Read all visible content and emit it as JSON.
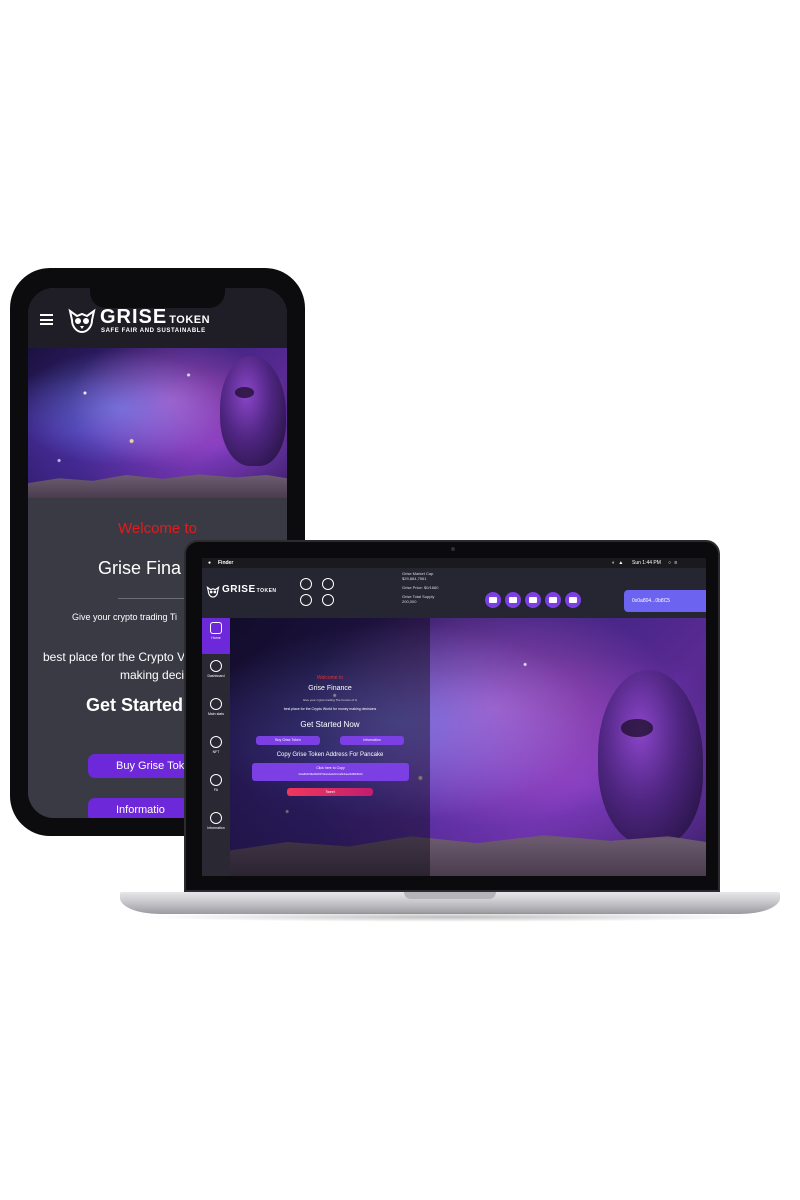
{
  "mobile": {
    "brand_name": "GRISE",
    "brand_suffix": "TOKEN",
    "tagline": "SAFE FAIR AND SUSTAINABLE",
    "welcome": "Welcome to",
    "title": "Grise Fina",
    "subtitle": "Give your crypto trading Ti",
    "best_line": "best place for the Crypto V",
    "making_line": "making decisi",
    "get_started": "Get Started",
    "buy_button": "Buy Grise Tok",
    "info_button": "Informatio",
    "colors": {
      "accent": "#6d28d9",
      "welcome": "#e51b1b"
    }
  },
  "laptop": {
    "menubar": {
      "app": "Finder",
      "clock": "Sun 1:44 PM"
    },
    "brand_name": "GRISE",
    "brand_suffix": "TOKEN",
    "stats": {
      "market_cap_label": "Grise Market Cap",
      "market_cap_value": "$29,884,7561",
      "price_label": "Grise Price: $0/1680",
      "supply_label": "Grise Total Supply",
      "supply_value": "200,000"
    },
    "wallet": "0x0a804...0b8C5",
    "sidebar": [
      "Home",
      "Dashboard",
      "Main stats",
      "NFT",
      "FA",
      "Information"
    ],
    "content": {
      "welcome": "Welcome to",
      "title": "Grise Finance",
      "subtitle": "Give your crypto trading The Forces of G",
      "best": "best place for the Crypto World for money making decisions",
      "get_started": "Get Started Now",
      "buy_button": "Buy Grise Token",
      "info_button": "Information",
      "copy_heading": "Copy Grise Token Address For Pancake",
      "click_copy": "Click here to Copy",
      "address": "0x0a804c59e63f2047fde2aba2e5cc1a6bfcaed6496b5b29",
      "tweet_button": "Tweet"
    },
    "colors": {
      "accent": "#7b3fe4",
      "wallet": "#6c63f0"
    }
  }
}
